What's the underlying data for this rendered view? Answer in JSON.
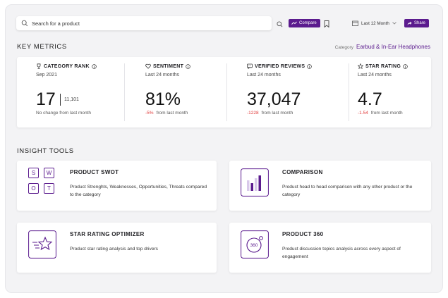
{
  "search": {
    "placeholder": "Search for a product"
  },
  "toolbar": {
    "compare_label": "Compare",
    "date_range": "Last 12 Month",
    "share_label": "Share"
  },
  "key_metrics": {
    "title": "KEY METRICS",
    "category_label": "Category",
    "category_value": "Earbud & In-Ear Headphones",
    "cards": [
      {
        "title": "CATEGORY RANK",
        "subtitle": "Sep 2021",
        "value": "17",
        "secondary": "11,101",
        "change": "",
        "footnote": "No change from last month",
        "icon": "trophy-icon"
      },
      {
        "title": "SENTIMENT",
        "subtitle": "Last 24 months",
        "value": "81%",
        "change": "-5%",
        "footnote": "from last month",
        "icon": "heart-icon"
      },
      {
        "title": "VERIFIED REVIEWS",
        "subtitle": "Last 24 months",
        "value": "37,047",
        "change": "-1228",
        "footnote": "from last month",
        "icon": "chat-icon"
      },
      {
        "title": "STAR RATING",
        "subtitle": "Last 24 months",
        "value": "4.7",
        "change": "-1.54",
        "footnote": "from last month",
        "icon": "star-icon"
      }
    ]
  },
  "insight_tools": {
    "title": "INSIGHT TOOLS",
    "swot_letters": [
      "S",
      "W",
      "O",
      "T"
    ],
    "tools": [
      {
        "title": "PRODUCT SWOT",
        "description": "Product Strenghts, Weaknesses, Opportunities, Threats compared to the category",
        "icon": "swot-icon"
      },
      {
        "title": "COMPARISON",
        "description": "Product head to head comparison with any other product or the category",
        "icon": "bar-chart-icon"
      },
      {
        "title": "STAR RATING OPTIMIZER",
        "description": "Product star rating analysis and top drivers",
        "icon": "star-speed-icon"
      },
      {
        "title": "PRODUCT 360",
        "description": "Product discussion topics analysis across every aspect of engagement",
        "icon": "360-icon",
        "badge": "360"
      }
    ]
  },
  "colors": {
    "accent": "#5b1b8e",
    "negative": "#e03a3a",
    "background": "#f3f3f5"
  }
}
